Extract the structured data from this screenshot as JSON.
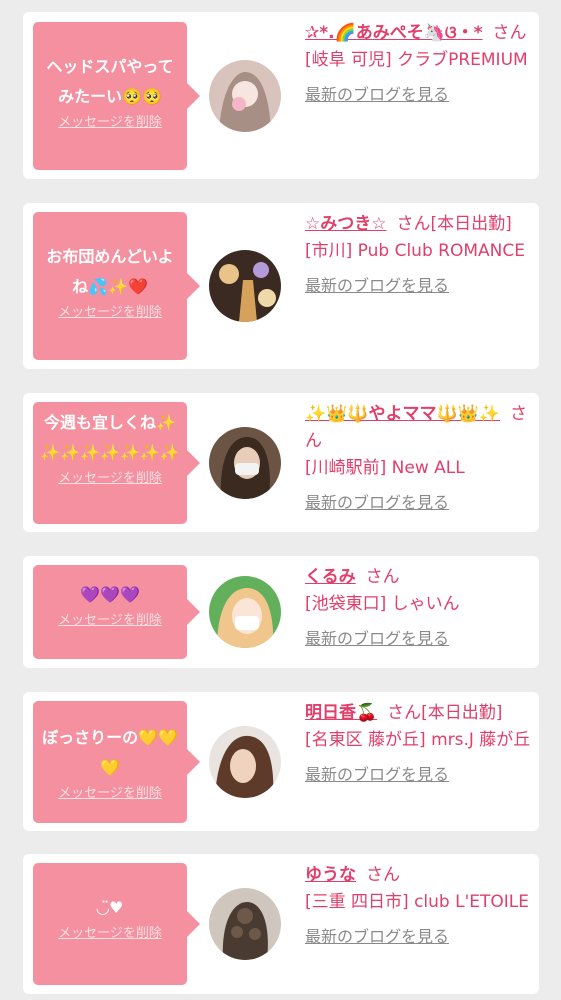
{
  "delete_label": "メッセージを削除",
  "blog_label": "最新のブログを見る",
  "honorific": "さん",
  "colors": {
    "bubble": "#f4909f",
    "accent": "#e23e6a",
    "muted": "#8a8a8a",
    "card": "#ffffff",
    "page_bg": "#ececec"
  },
  "items": [
    {
      "message": "ヘッドスパやってみたーい🥺🥺",
      "name": "✰*.🌈あみぺそ🦄ଓ・*",
      "status": "",
      "area": "[岐阜 可児]",
      "shop": "クラブPREMIUM",
      "avatar": "avatar-photo-1"
    },
    {
      "message": "お布団めんどいよね💦✨❤️",
      "name": "☆みつき☆",
      "status": "[本日出勤]",
      "area": "[市川]",
      "shop": "Pub Club ROMANCE",
      "avatar": "avatar-photo-2"
    },
    {
      "message": "今週も宜しくね✨✨✨✨✨✨✨✨",
      "name": "✨👑🔱やよママ🔱👑✨",
      "status": "",
      "area": "[川崎駅前]",
      "shop": "New ALL",
      "avatar": "avatar-photo-3"
    },
    {
      "message": "💜💜💜",
      "name": "くるみ",
      "status": "",
      "area": "[池袋東口]",
      "shop": "しゃいん",
      "avatar": "avatar-photo-4"
    },
    {
      "message": "ぼっさりーの💛💛💛",
      "name": "明日香🍒",
      "status": "[本日出勤]",
      "area": "[名東区 藤が丘]",
      "shop": "mrs.J 藤が丘",
      "avatar": "avatar-photo-5"
    },
    {
      "message": "◡̈♥︎",
      "name": "ゆうな",
      "status": "",
      "area": "[三重 四日市]",
      "shop": "club L'ETOILE",
      "avatar": "avatar-photo-6"
    }
  ]
}
